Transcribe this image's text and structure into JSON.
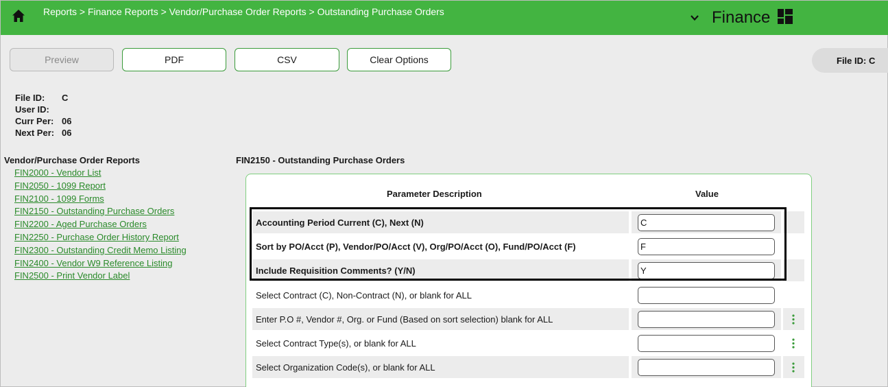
{
  "header": {
    "breadcrumb": "Reports > Finance Reports > Vendor/Purchase Order Reports > Outstanding Purchase Orders",
    "module": "Finance",
    "icons": [
      "home-icon",
      "chevron-down-icon",
      "apps-grid-icon"
    ],
    "brand_color": "#43b441"
  },
  "toolbar": {
    "preview_label": "Preview",
    "pdf_label": "PDF",
    "csv_label": "CSV",
    "clear_label": "Clear Options",
    "fileid_pill": "File ID: C"
  },
  "info": {
    "file_id_label": "File ID:",
    "file_id_value": "C",
    "user_id_label": "User ID:",
    "user_id_value": "",
    "curr_per_label": "Curr Per:",
    "curr_per_value": "06",
    "next_per_label": "Next Per:",
    "next_per_value": "06"
  },
  "nav": {
    "title": "Vendor/Purchase Order Reports",
    "items": [
      "FIN2000 - Vendor List",
      "FIN2050 - 1099 Report",
      "FIN2100 - 1099 Forms",
      "FIN2150 - Outstanding Purchase Orders",
      "FIN2200 - Aged Purchase Orders",
      "FIN2250 - Purchase Order History Report",
      "FIN2300 - Outstanding Credit Memo Listing",
      "FIN2400 - Vendor W9 Reference Listing",
      "FIN2500 - Print Vendor Label"
    ]
  },
  "main": {
    "title": "FIN2150 - Outstanding Purchase Orders",
    "col_description": "Parameter Description",
    "col_value": "Value",
    "params": [
      {
        "description": "Accounting Period Current (C), Next (N)",
        "value": "C"
      },
      {
        "description": "Sort by PO/Acct (P), Vendor/PO/Acct (V), Org/PO/Acct (O), Fund/PO/Acct (F)",
        "value": "F"
      },
      {
        "description": "Include Requisition Comments? (Y/N)",
        "value": "Y"
      },
      {
        "description": "Select Contract (C), Non-Contract (N), or blank for ALL",
        "value": ""
      },
      {
        "description": "Enter P.O #, Vendor #, Org. or Fund (Based on sort selection) blank for ALL",
        "value": ""
      },
      {
        "description": "Select Contract Type(s), or blank for ALL",
        "value": ""
      },
      {
        "description": "Select Organization Code(s), or blank for ALL",
        "value": ""
      }
    ]
  }
}
